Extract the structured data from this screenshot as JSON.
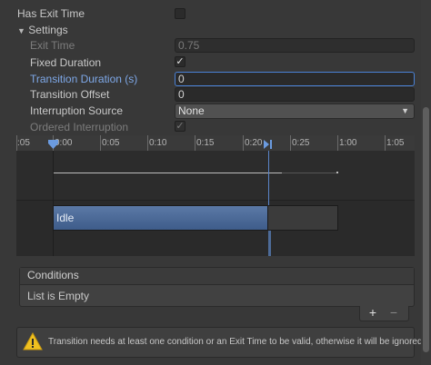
{
  "fields": {
    "has_exit_time": {
      "label": "Has Exit Time",
      "checked": false
    },
    "settings_label": "Settings",
    "exit_time": {
      "label": "Exit Time",
      "value": "0.75"
    },
    "fixed_duration": {
      "label": "Fixed Duration",
      "check": "✓"
    },
    "transition_duration": {
      "label": "Transition Duration (s)",
      "value": "0"
    },
    "transition_offset": {
      "label": "Transition Offset",
      "value": "0"
    },
    "interruption_source": {
      "label": "Interruption Source",
      "value": "None"
    },
    "ordered_interruption": {
      "label": "Ordered Interruption",
      "check": "✓"
    }
  },
  "timeline": {
    "ticks": [
      ":05",
      "0:00",
      "0:05",
      "0:10",
      "0:15",
      "0:20",
      "0:25",
      "1:00",
      "1:05"
    ],
    "source_state": "Idle"
  },
  "conditions": {
    "header": "Conditions",
    "empty_text": "List is Empty",
    "add_label": "+",
    "remove_label": "−"
  },
  "warning": {
    "text": "Transition needs at least one condition or an Exit Time to be valid, otherwise it will be ignored."
  },
  "colors": {
    "accent": "#4a82d6",
    "warning_icon": "#f0c020",
    "source_bar": "#4d6b98"
  }
}
